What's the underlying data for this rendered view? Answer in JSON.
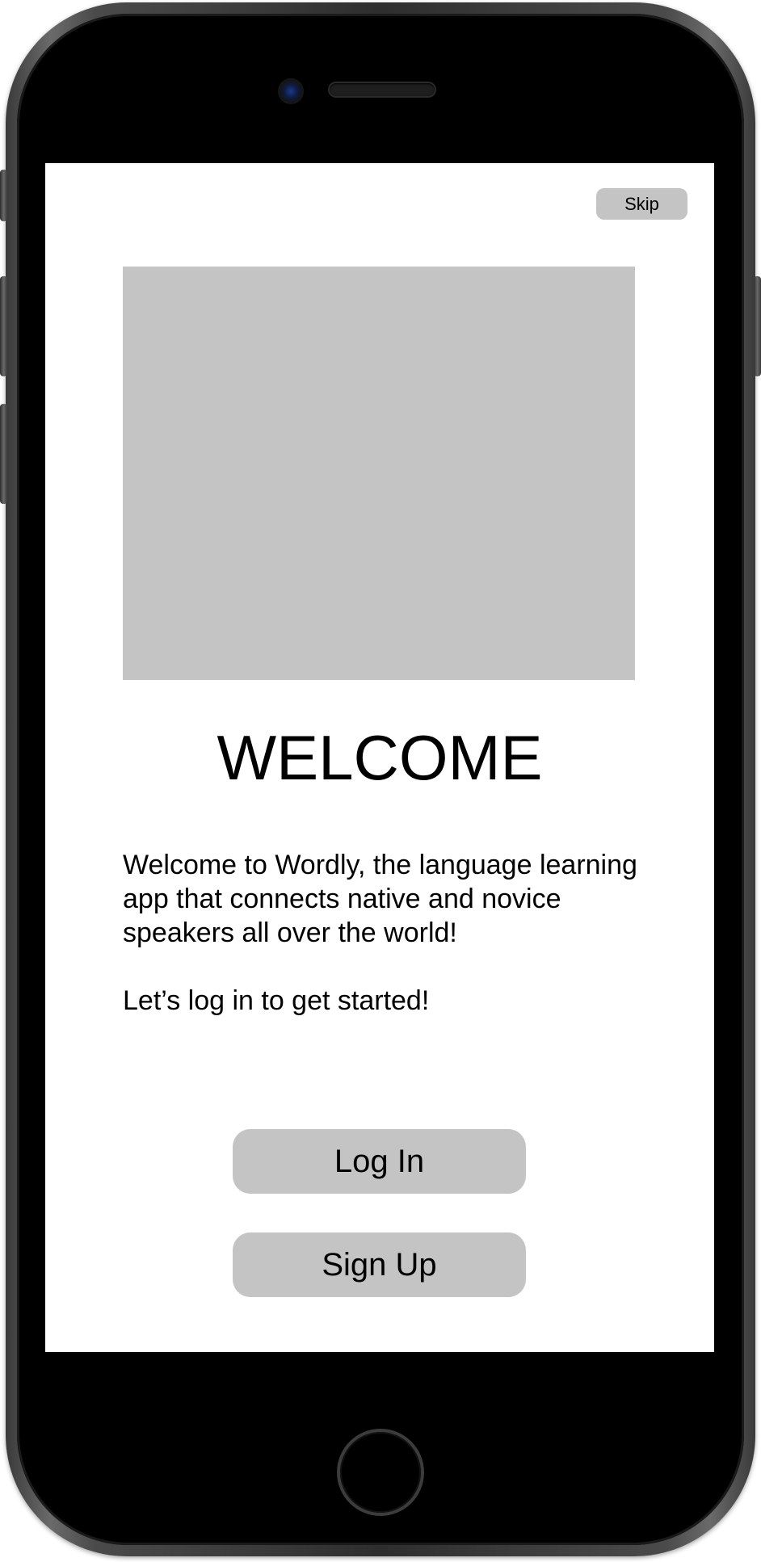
{
  "screen": {
    "skip_label": "Skip",
    "title": "WELCOME",
    "intro": "Welcome to Wordly, the language learning app that connects native and novice speakers all over the world!",
    "cta": "Let’s log in to get started!",
    "login_label": "Log In",
    "signup_label": "Sign Up"
  },
  "colors": {
    "button_background": "#c4c4c4",
    "screen_background": "#ffffff",
    "device_frame": "#000000"
  }
}
